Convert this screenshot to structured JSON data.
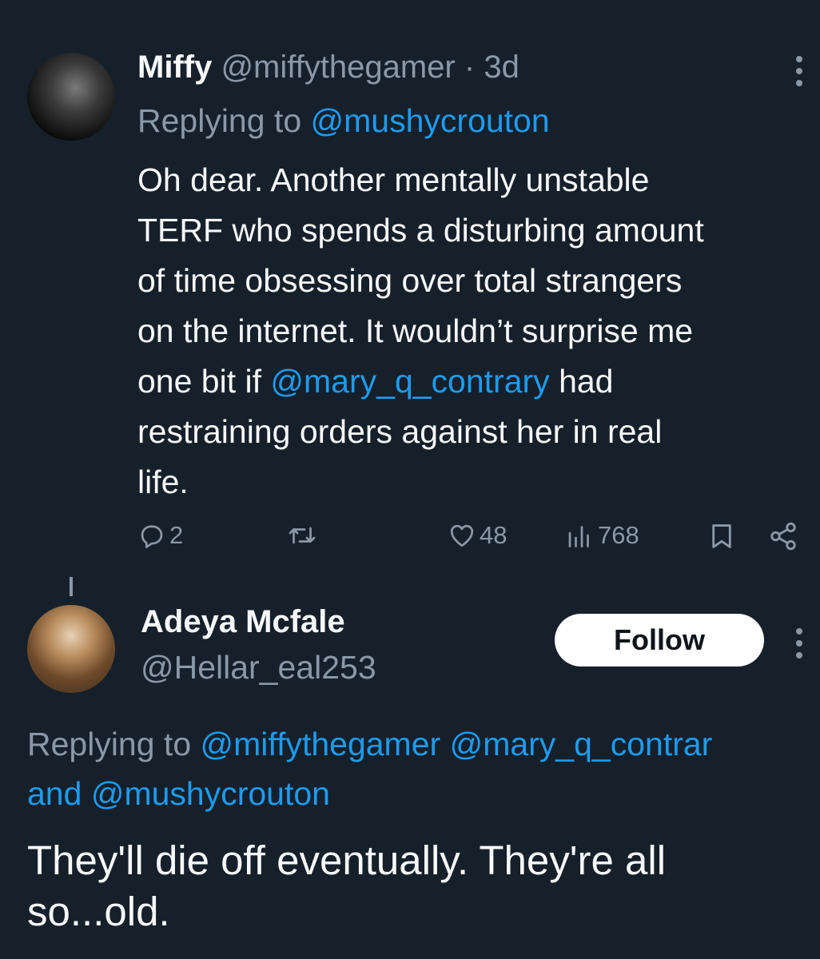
{
  "tweet1": {
    "display_name": "Miffy",
    "handle": "@miffythegamer",
    "separator": "·",
    "time": "3d",
    "replying_prefix": "Replying to",
    "replying_handle": "@mushycrouton",
    "text_lines": [
      "Oh dear. Another mentally unstable",
      "TERF who spends a disturbing amount",
      "of time obsessing over total strangers",
      "on the internet. It wouldn’t surprise me"
    ],
    "text_line5_before": "one bit if",
    "text_line5_mention": "@mary_q_contrary",
    "text_line5_after": "had",
    "text_line6": "restraining orders against her in real",
    "text_line7": "life.",
    "actions": {
      "replies": "2",
      "likes": "48",
      "views": "768"
    },
    "icons": [
      "reply-icon",
      "retweet-icon",
      "like-icon",
      "views-icon",
      "bookmark-icon",
      "share-icon",
      "more-icon"
    ]
  },
  "tweet2": {
    "display_name": "Adeya Mcfale",
    "handle": "@Hellar_eal253",
    "follow_label": "Follow",
    "replying_prefix": "Replying to",
    "replying_handle1": "@miffythegamer",
    "replying_handle2": "@mary_q_contrar",
    "replying_and": "and",
    "replying_handle3": "@mushycrouton",
    "text_line1": "They'll die off eventually. They're all",
    "text_line2": "so...old."
  },
  "colors": {
    "background": "#15202b",
    "text": "#f7f9f9",
    "muted": "#8b98a5",
    "link": "#1d9bf0",
    "button": "#ffffff"
  }
}
